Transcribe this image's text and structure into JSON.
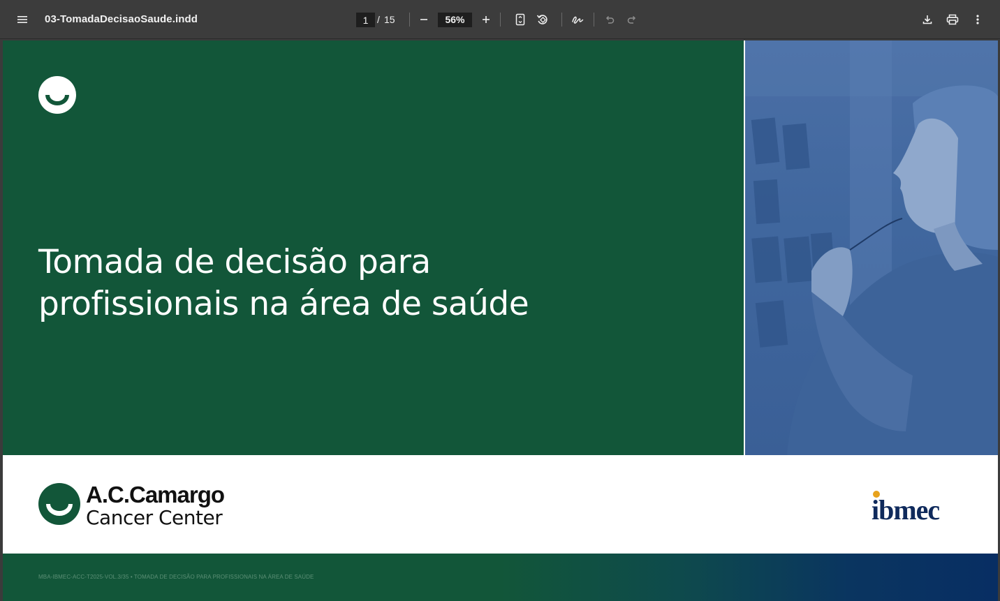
{
  "toolbar": {
    "menu_icon": "menu-icon",
    "title": "03-TomadaDecisaoSaude.indd",
    "page_current": "1",
    "page_separator": "/",
    "page_total": "15",
    "zoom": "56%",
    "icons": {
      "zoom_out": "minus-icon",
      "zoom_in": "plus-icon",
      "fit": "fit-page-icon",
      "rotate": "rotate-icon",
      "annotate": "draw-icon",
      "undo": "undo-icon",
      "redo": "redo-icon",
      "download": "download-icon",
      "print": "print-icon",
      "more": "more-vertical-icon"
    }
  },
  "page": {
    "cover_title_line1": "Tomada de decisão para",
    "cover_title_line2": "profissionais na área de saúde",
    "acc_logo_line1": "A.C.Camargo",
    "acc_logo_line2": "Cancer Center",
    "ibmec_logo": "ibmec",
    "footer": "MBA-IBMEC-ACC-T2025-VOL.3/35 • TOMADA DE DECISÃO PARA PROFISSIONAIS NA ÁREA DE SAÚDE"
  },
  "colors": {
    "toolbar_bg": "#3c3c3c",
    "brand_green": "#125639",
    "photo_blue": "#4b6fa6",
    "ibmec_navy": "#0f2a5c",
    "ibmec_dot": "#e7a21c"
  }
}
